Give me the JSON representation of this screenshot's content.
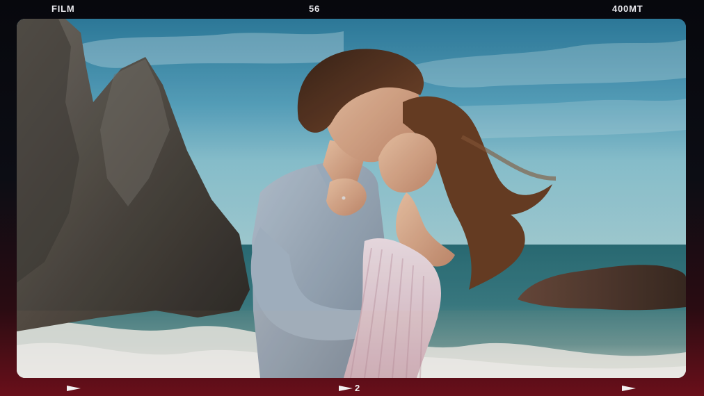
{
  "header": {
    "left_label": "FILM",
    "center_label": "56",
    "right_label": "400MT"
  },
  "footer": {
    "frame_number": "2",
    "markers": [
      "left",
      "center",
      "right"
    ]
  },
  "photo": {
    "subject": "couple-kissing-on-beach",
    "icon": "film-frame-photo"
  },
  "colors": {
    "frame_top": "#07080d",
    "frame_bottom": "#6a0f1a",
    "label": "#e9e9ee",
    "sky": "#5da7c2",
    "sea": "#3b7c84"
  }
}
